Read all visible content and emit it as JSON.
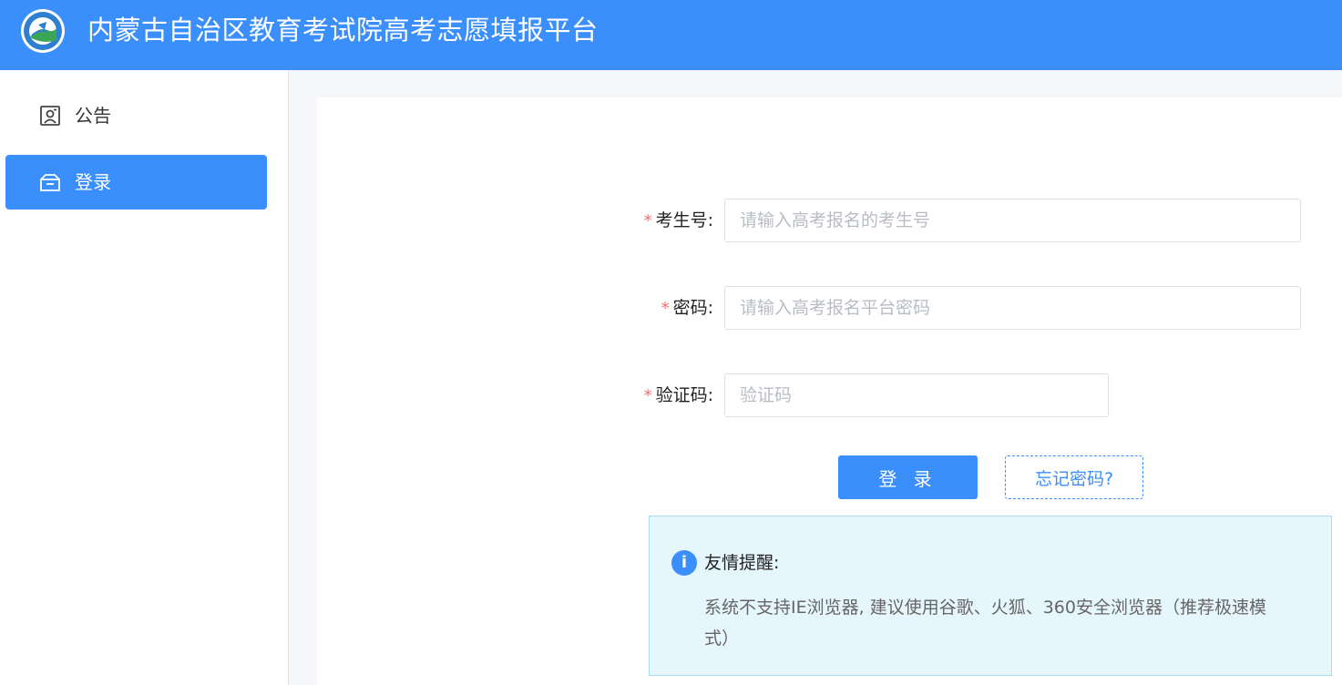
{
  "header": {
    "title": "内蒙古自治区教育考试院高考志愿填报平台",
    "logo_icon": "exam-institute-logo"
  },
  "sidebar": {
    "items": [
      {
        "label": "公告",
        "icon": "announcement-icon",
        "active": false
      },
      {
        "label": "登录",
        "icon": "login-icon",
        "active": true
      }
    ]
  },
  "form": {
    "required_mark": "*",
    "exam_id": {
      "label": "考生号:",
      "placeholder": "请输入高考报名的考生号",
      "value": ""
    },
    "password": {
      "label": "密码:",
      "placeholder": "请输入高考报名平台密码",
      "value": ""
    },
    "captcha": {
      "label": "验证码:",
      "placeholder": "验证码",
      "value": ""
    },
    "login_button": "登 录",
    "forgot_button": "忘记密码?"
  },
  "notice": {
    "icon": "info-icon",
    "icon_glyph": "i",
    "title": "友情提醒:",
    "text": "系统不支持IE浏览器, 建议使用谷歌、火狐、360安全浏览器（推荐极速模式）"
  },
  "colors": {
    "primary": "#3a8ffc",
    "required": "#f56c6c",
    "notice_bg": "#e6f6fd"
  }
}
